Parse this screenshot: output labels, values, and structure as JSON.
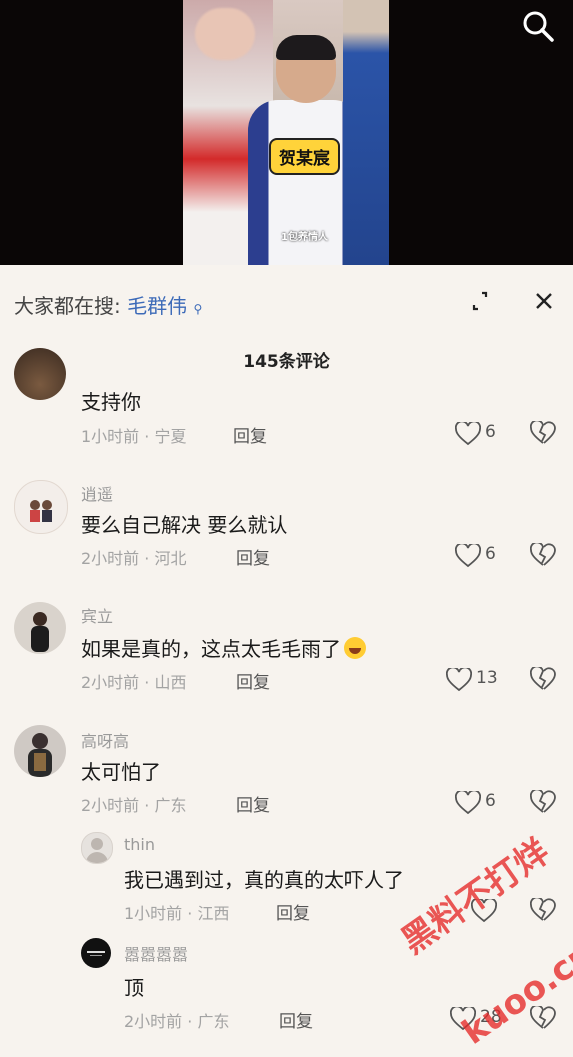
{
  "video": {
    "name_tag": "贺某宸",
    "caption": "1包养情人"
  },
  "hot_search": {
    "prefix": "大家都在搜:",
    "keyword": "毛群伟"
  },
  "comment_count": "145条评论",
  "comments": [
    {
      "name": "",
      "text": "支持你",
      "meta": "1小时前 · 宁夏",
      "reply": "回复",
      "likes": "6"
    },
    {
      "name": "逍遥",
      "text": "要么自己解决 要么就认",
      "meta": "2小时前 · 河北",
      "reply": "回复",
      "likes": "6"
    },
    {
      "name": "宾立",
      "text": "如果是真的，这点太毛毛雨了",
      "meta": "2小时前 · 山西",
      "reply": "回复",
      "likes": "13"
    },
    {
      "name": "高呀高",
      "text": "太可怕了",
      "meta": "2小时前 · 广东",
      "reply": "回复",
      "likes": "6"
    },
    {
      "name": "thin",
      "text": "我已遇到过，真的真的太吓人了",
      "meta": "1小时前 · 江西",
      "reply": "回复",
      "likes": ""
    },
    {
      "name": "嚣嚣嚣嚣",
      "text": "顶",
      "meta": "2小时前 · 广东",
      "reply": "回复",
      "likes": "28"
    }
  ],
  "watermark": {
    "line1": "黑料不打烊",
    "line2": "kuoo.cn"
  }
}
